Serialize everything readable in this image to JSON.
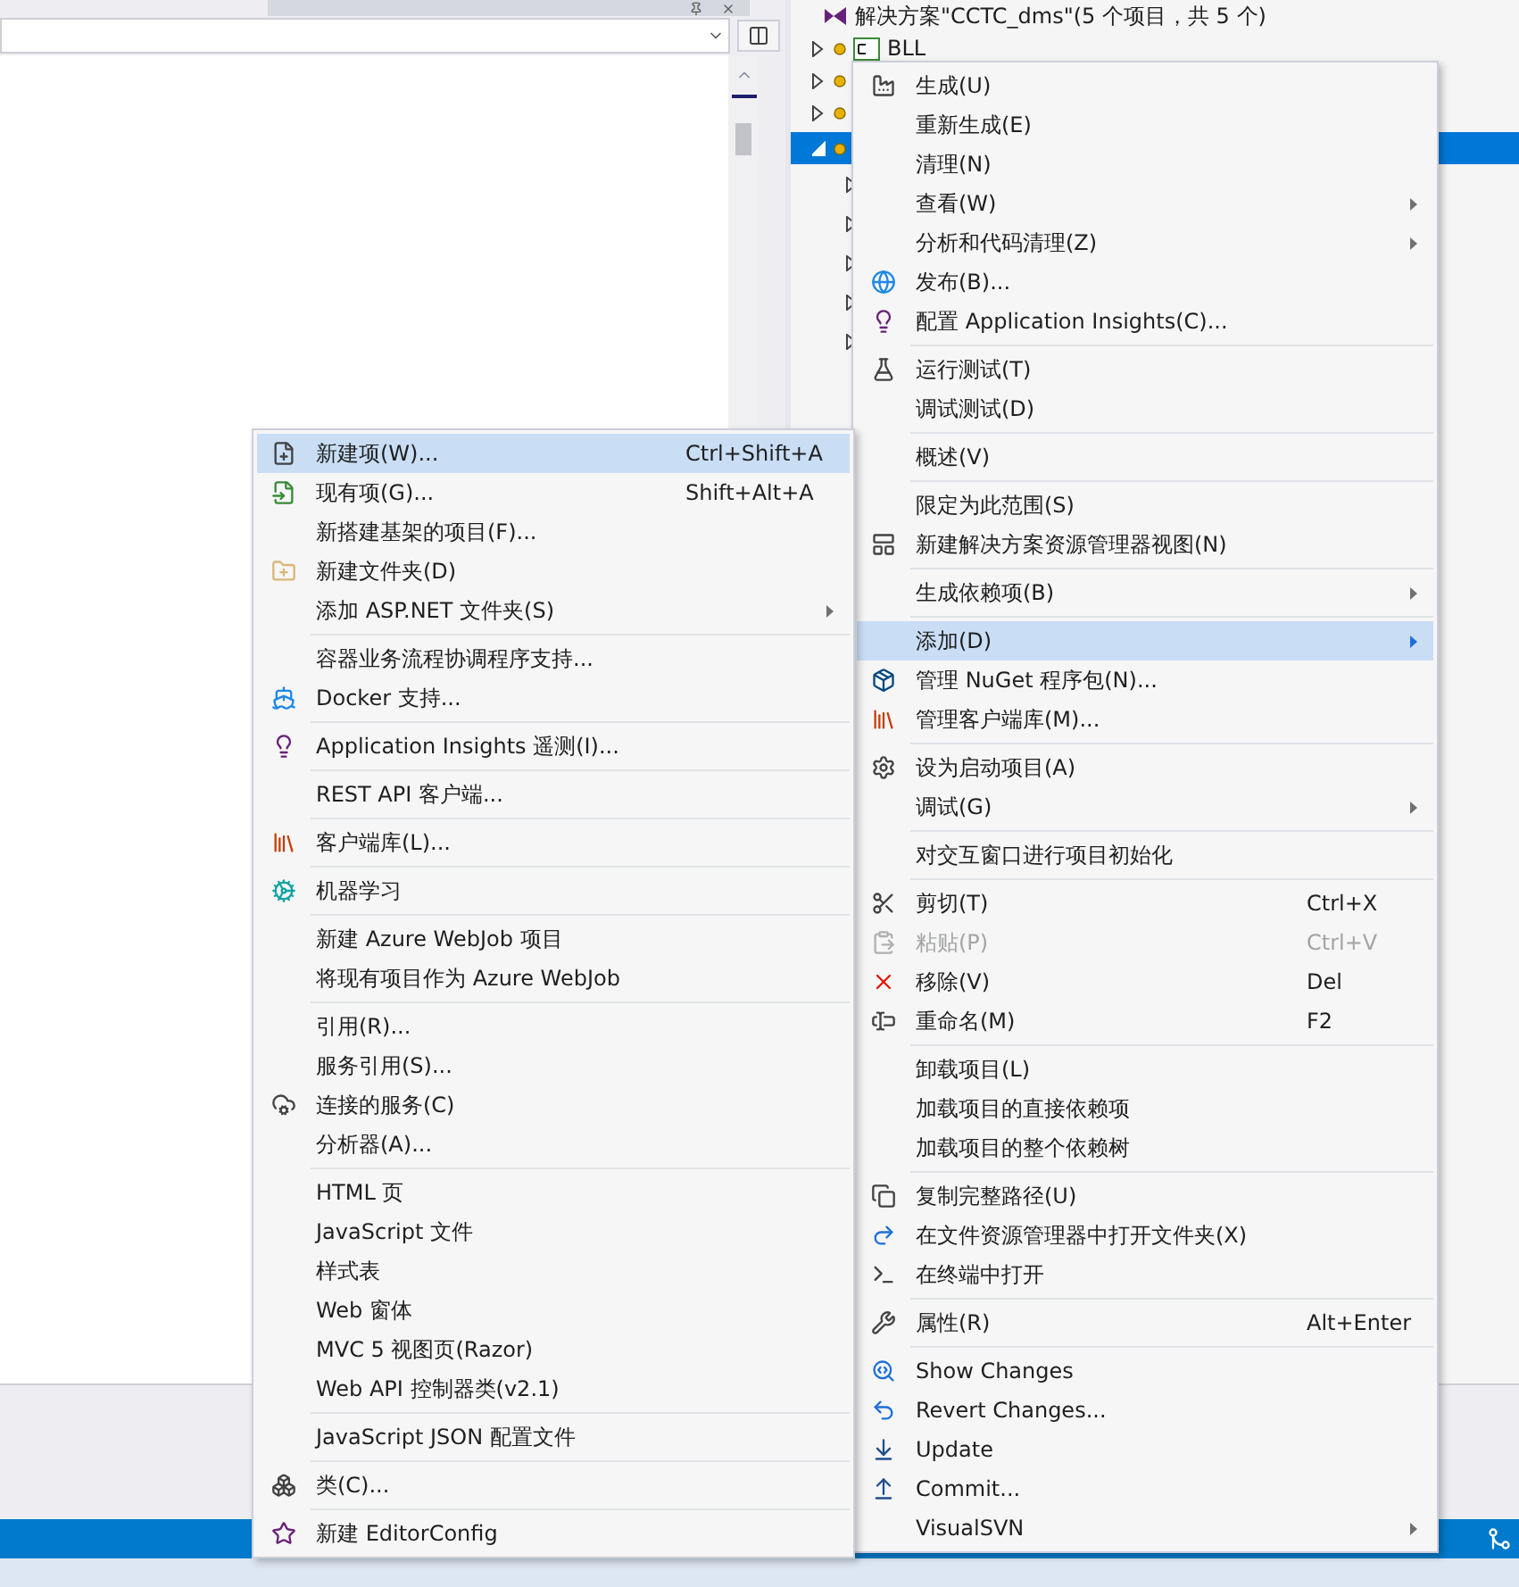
{
  "solution_explorer": {
    "items": [
      {
        "label": "解决方案\"CCTC_dms\"(5 个项目，共 5 个)",
        "kind": "solution",
        "selected": false
      },
      {
        "label": "BLL",
        "kind": "project",
        "expanded": false,
        "selected": false
      },
      {
        "kind": "project",
        "expanded": false,
        "selected": false
      },
      {
        "kind": "project",
        "expanded": false,
        "selected": false
      },
      {
        "kind": "project",
        "expanded": true,
        "selected": true,
        "children": [
          {
            "kind": "folder",
            "expanded": false,
            "selected": false
          },
          {
            "kind": "folder",
            "expanded": false,
            "selected": false
          },
          {
            "kind": "folder",
            "expanded": false,
            "selected": false
          },
          {
            "kind": "folder",
            "expanded": false,
            "selected": false
          },
          {
            "kind": "folder",
            "expanded": false,
            "selected": false
          }
        ]
      }
    ]
  },
  "context_menu": {
    "items": [
      {
        "kind": "item",
        "label": "生成(U)",
        "selected": false,
        "disabled": false,
        "submenu": false
      },
      {
        "kind": "item",
        "label": "重新生成(E)",
        "selected": false,
        "disabled": false,
        "submenu": false
      },
      {
        "kind": "item",
        "label": "清理(N)",
        "selected": false,
        "disabled": false,
        "submenu": false
      },
      {
        "kind": "item",
        "label": "查看(W)",
        "selected": false,
        "disabled": false,
        "submenu": true
      },
      {
        "kind": "item",
        "label": "分析和代码清理(Z)",
        "selected": false,
        "disabled": false,
        "submenu": true
      },
      {
        "kind": "item",
        "label": "发布(B)...",
        "selected": false,
        "disabled": false,
        "submenu": false
      },
      {
        "kind": "item",
        "label": "配置 Application Insights(C)...",
        "selected": false,
        "disabled": false,
        "submenu": false
      },
      {
        "kind": "separator"
      },
      {
        "kind": "item",
        "label": "运行测试(T)",
        "selected": false,
        "disabled": false,
        "submenu": false
      },
      {
        "kind": "item",
        "label": "调试测试(D)",
        "selected": false,
        "disabled": false,
        "submenu": false
      },
      {
        "kind": "separator"
      },
      {
        "kind": "item",
        "label": "概述(V)",
        "selected": false,
        "disabled": false,
        "submenu": false
      },
      {
        "kind": "separator"
      },
      {
        "kind": "item",
        "label": "限定为此范围(S)",
        "selected": false,
        "disabled": false,
        "submenu": false
      },
      {
        "kind": "item",
        "label": "新建解决方案资源管理器视图(N)",
        "selected": false,
        "disabled": false,
        "submenu": false
      },
      {
        "kind": "separator"
      },
      {
        "kind": "item",
        "label": "生成依赖项(B)",
        "selected": false,
        "disabled": false,
        "submenu": true
      },
      {
        "kind": "separator"
      },
      {
        "kind": "item",
        "label": "添加(D)",
        "selected": true,
        "disabled": false,
        "submenu": true
      },
      {
        "kind": "item",
        "label": "管理 NuGet 程序包(N)...",
        "selected": false,
        "disabled": false,
        "submenu": false
      },
      {
        "kind": "item",
        "label": "管理客户端库(M)...",
        "selected": false,
        "disabled": false,
        "submenu": false
      },
      {
        "kind": "separator"
      },
      {
        "kind": "item",
        "label": "设为启动项目(A)",
        "selected": false,
        "disabled": false,
        "submenu": false
      },
      {
        "kind": "item",
        "label": "调试(G)",
        "selected": false,
        "disabled": false,
        "submenu": true
      },
      {
        "kind": "separator"
      },
      {
        "kind": "item",
        "label": "对交互窗口进行项目初始化",
        "selected": false,
        "disabled": false,
        "submenu": false
      },
      {
        "kind": "separator"
      },
      {
        "kind": "item",
        "label": "剪切(T)",
        "shortcut": "Ctrl+X",
        "selected": false,
        "disabled": false,
        "submenu": false
      },
      {
        "kind": "item",
        "label": "粘贴(P)",
        "shortcut": "Ctrl+V",
        "selected": false,
        "disabled": true,
        "submenu": false
      },
      {
        "kind": "item",
        "label": "移除(V)",
        "shortcut": "Del",
        "selected": false,
        "disabled": false,
        "submenu": false
      },
      {
        "kind": "item",
        "label": "重命名(M)",
        "shortcut": "F2",
        "selected": false,
        "disabled": false,
        "submenu": false
      },
      {
        "kind": "separator"
      },
      {
        "kind": "item",
        "label": "卸载项目(L)",
        "selected": false,
        "disabled": false,
        "submenu": false
      },
      {
        "kind": "item",
        "label": "加载项目的直接依赖项",
        "selected": false,
        "disabled": false,
        "submenu": false
      },
      {
        "kind": "item",
        "label": "加载项目的整个依赖树",
        "selected": false,
        "disabled": false,
        "submenu": false
      },
      {
        "kind": "separator"
      },
      {
        "kind": "item",
        "label": "复制完整路径(U)",
        "selected": false,
        "disabled": false,
        "submenu": false
      },
      {
        "kind": "item",
        "label": "在文件资源管理器中打开文件夹(X)",
        "selected": false,
        "disabled": false,
        "submenu": false
      },
      {
        "kind": "item",
        "label": "在终端中打开",
        "selected": false,
        "disabled": false,
        "submenu": false
      },
      {
        "kind": "separator"
      },
      {
        "kind": "item",
        "label": "属性(R)",
        "shortcut": "Alt+Enter",
        "selected": false,
        "disabled": false,
        "submenu": false
      },
      {
        "kind": "separator"
      },
      {
        "kind": "item",
        "label": "Show Changes",
        "selected": false,
        "disabled": false,
        "submenu": false
      },
      {
        "kind": "item",
        "label": "Revert Changes...",
        "selected": false,
        "disabled": false,
        "submenu": false
      },
      {
        "kind": "item",
        "label": "Update",
        "selected": false,
        "disabled": false,
        "submenu": false
      },
      {
        "kind": "item",
        "label": "Commit...",
        "selected": false,
        "disabled": false,
        "submenu": false
      },
      {
        "kind": "item",
        "label": "VisualSVN",
        "selected": false,
        "disabled": false,
        "submenu": true
      }
    ]
  },
  "add_submenu": {
    "items": [
      {
        "kind": "item",
        "label": "新建项(W)...",
        "shortcut": "Ctrl+Shift+A",
        "selected": true,
        "disabled": false,
        "submenu": false
      },
      {
        "kind": "item",
        "label": "现有项(G)...",
        "shortcut": "Shift+Alt+A",
        "selected": false,
        "disabled": false,
        "submenu": false
      },
      {
        "kind": "item",
        "label": "新搭建基架的项目(F)...",
        "selected": false,
        "disabled": false,
        "submenu": false
      },
      {
        "kind": "item",
        "label": "新建文件夹(D)",
        "selected": false,
        "disabled": false,
        "submenu": false
      },
      {
        "kind": "item",
        "label": "添加 ASP.NET 文件夹(S)",
        "selected": false,
        "disabled": false,
        "submenu": true
      },
      {
        "kind": "separator"
      },
      {
        "kind": "item",
        "label": "容器业务流程协调程序支持...",
        "selected": false,
        "disabled": false,
        "submenu": false
      },
      {
        "kind": "item",
        "label": "Docker 支持...",
        "selected": false,
        "disabled": false,
        "submenu": false
      },
      {
        "kind": "separator"
      },
      {
        "kind": "item",
        "label": "Application Insights 遥测(I)...",
        "selected": false,
        "disabled": false,
        "submenu": false
      },
      {
        "kind": "separator"
      },
      {
        "kind": "item",
        "label": "REST API 客户端...",
        "selected": false,
        "disabled": false,
        "submenu": false
      },
      {
        "kind": "separator"
      },
      {
        "kind": "item",
        "label": "客户端库(L)...",
        "selected": false,
        "disabled": false,
        "submenu": false
      },
      {
        "kind": "separator"
      },
      {
        "kind": "item",
        "label": "机器学习",
        "selected": false,
        "disabled": false,
        "submenu": false
      },
      {
        "kind": "separator"
      },
      {
        "kind": "item",
        "label": "新建 Azure WebJob 项目",
        "selected": false,
        "disabled": false,
        "submenu": false
      },
      {
        "kind": "item",
        "label": "将现有项目作为 Azure WebJob",
        "selected": false,
        "disabled": false,
        "submenu": false
      },
      {
        "kind": "separator"
      },
      {
        "kind": "item",
        "label": "引用(R)...",
        "selected": false,
        "disabled": false,
        "submenu": false
      },
      {
        "kind": "item",
        "label": "服务引用(S)...",
        "selected": false,
        "disabled": false,
        "submenu": false
      },
      {
        "kind": "item",
        "label": "连接的服务(C)",
        "selected": false,
        "disabled": false,
        "submenu": false
      },
      {
        "kind": "item",
        "label": "分析器(A)...",
        "selected": false,
        "disabled": false,
        "submenu": false
      },
      {
        "kind": "separator"
      },
      {
        "kind": "item",
        "label": "HTML 页",
        "selected": false,
        "disabled": false,
        "submenu": false
      },
      {
        "kind": "item",
        "label": "JavaScript 文件",
        "selected": false,
        "disabled": false,
        "submenu": false
      },
      {
        "kind": "item",
        "label": "样式表",
        "selected": false,
        "disabled": false,
        "submenu": false
      },
      {
        "kind": "item",
        "label": "Web 窗体",
        "selected": false,
        "disabled": false,
        "submenu": false
      },
      {
        "kind": "item",
        "label": "MVC 5 视图页(Razor)",
        "selected": false,
        "disabled": false,
        "submenu": false
      },
      {
        "kind": "item",
        "label": "Web API 控制器类(v2.1)",
        "selected": false,
        "disabled": false,
        "submenu": false
      },
      {
        "kind": "separator"
      },
      {
        "kind": "item",
        "label": "JavaScript JSON 配置文件",
        "selected": false,
        "disabled": false,
        "submenu": false
      },
      {
        "kind": "separator"
      },
      {
        "kind": "item",
        "label": "类(C)...",
        "selected": false,
        "disabled": false,
        "submenu": false
      },
      {
        "kind": "separator"
      },
      {
        "kind": "item",
        "label": "新建 EditorConfig",
        "selected": false,
        "disabled": false,
        "submenu": false
      }
    ]
  }
}
